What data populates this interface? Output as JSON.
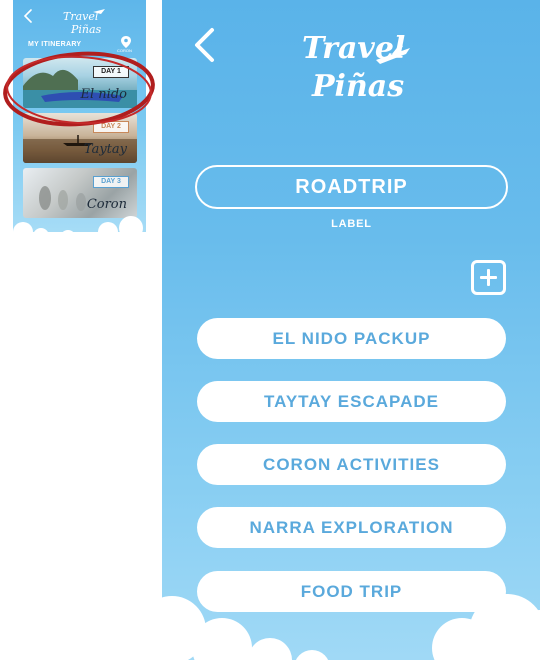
{
  "mini": {
    "section_title": "MY ITINERARY",
    "pin_label": "CORON",
    "cards": [
      {
        "day": "DAY 1",
        "place": "El nido"
      },
      {
        "day": "DAY 2",
        "place": "Taytay"
      },
      {
        "day": "DAY 3",
        "place": "Coron"
      }
    ],
    "highlight_color": "#b01e1e"
  },
  "logo": {
    "line1": "Travel",
    "line2": "Piñas"
  },
  "trip": {
    "name": "ROADTRIP",
    "caption": "LABEL"
  },
  "buttons": [
    "EL NIDO PACKUP",
    "TAYTAY ESCAPADE",
    "CORON ACTIVITIES",
    "NARRA EXPLORATION",
    "FOOD TRIP"
  ],
  "colors": {
    "sky_top": "#5ab3e9",
    "sky_bottom": "#a2daf6",
    "button_text": "#5aa9dc",
    "white": "#ffffff"
  },
  "icons": [
    "back-arrow-icon",
    "location-pin-icon",
    "add-square-icon",
    "plane-icon"
  ]
}
